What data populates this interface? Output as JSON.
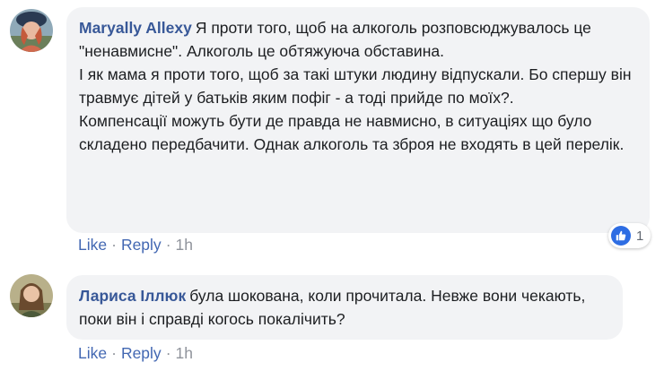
{
  "comments": [
    {
      "author": "Maryally Allexy",
      "text_first": "Я проти того, щоб на алкоголь розповсюджувалось це \"ненавмисне\". Алкоголь це обтяжуюча обставина.",
      "text_second": "І як мама я проти того, щоб за такі штуки людину відпускали. Бо спершу він травмує дітей у батьків яким пофіг - а тоді прийде по моїх?.",
      "text_third": "Компенсації можуть бути де правда не навмисно, в ситуаціях що було складено передбачити. Однак алкоголь та зброя не входять в цей перелік.",
      "like_label": "Like",
      "reply_label": "Reply",
      "time": "1h",
      "reaction_icon": "like-icon",
      "reaction_count": "1"
    },
    {
      "author": "Лариса Іллюк",
      "text_first": "була шокована, коли прочитала. Невже вони чекають, поки він і справді когось покалічить?",
      "like_label": "Like",
      "reply_label": "Reply",
      "time": "1h"
    }
  ],
  "colors": {
    "author": "#385898",
    "link": "#4267b2",
    "meta": "#90949c",
    "bubble_bg": "#f2f3f5",
    "reaction_blue": "#2e6de3"
  }
}
